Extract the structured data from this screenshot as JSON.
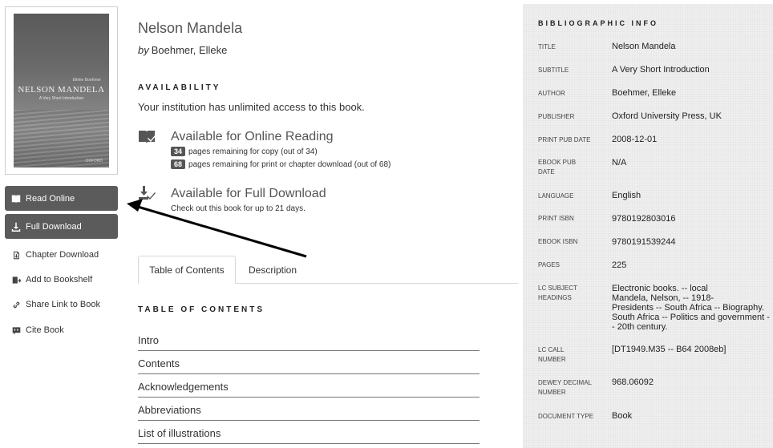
{
  "book": {
    "cover": {
      "author": "Elleke Boehmer",
      "title": "NELSON MANDELA",
      "subtitle": "A Very Short Introduction",
      "publisher": "OXFORD"
    },
    "title": "Nelson Mandela",
    "by_label": "by",
    "author": "Boehmer, Elleke"
  },
  "actions": {
    "read_online": "Read Online",
    "full_download": "Full Download",
    "chapter_download": "Chapter Download",
    "add_to_bookshelf": "Add to Bookshelf",
    "share_link": "Share Link to Book",
    "cite_book": "Cite Book"
  },
  "availability": {
    "heading": "AVAILABILITY",
    "access_text": "Your institution has unlimited access to this book.",
    "online": {
      "title": "Available for Online Reading",
      "copy_count": "34",
      "copy_text": "pages remaining for copy (out of 34)",
      "print_count": "68",
      "print_text": "pages remaining for print or chapter download (out of 68)"
    },
    "download": {
      "title": "Available for Full Download",
      "text": "Check out this book for up to 21 days."
    }
  },
  "tabs": [
    {
      "label": "Table of Contents",
      "active": true
    },
    {
      "label": "Description",
      "active": false
    }
  ],
  "toc": {
    "heading": "TABLE OF CONTENTS",
    "items": [
      "Intro",
      "Contents",
      "Acknowledgements",
      "Abbreviations",
      "List of illustrations"
    ]
  },
  "biblio": {
    "heading": "BIBLIOGRAPHIC INFO",
    "rows": [
      {
        "label": "TITLE",
        "value": "Nelson Mandela"
      },
      {
        "label": "SUBTITLE",
        "value": "A Very Short Introduction"
      },
      {
        "label": "AUTHOR",
        "value": "Boehmer, Elleke"
      },
      {
        "label": "PUBLISHER",
        "value": "Oxford University Press, UK"
      },
      {
        "label": "PRINT PUB DATE",
        "value": "2008-12-01"
      },
      {
        "label": "EBOOK PUB DATE",
        "value": "N/A"
      },
      {
        "label": "LANGUAGE",
        "value": "English"
      },
      {
        "label": "PRINT ISBN",
        "value": "9780192803016"
      },
      {
        "label": "EBOOK ISBN",
        "value": "9780191539244"
      },
      {
        "label": "PAGES",
        "value": "225"
      },
      {
        "label": "LC SUBJECT HEADINGS",
        "value": "Electronic books. -- local\nMandela, Nelson, -- 1918-\nPresidents -- South Africa -- Biography.\nSouth Africa -- Politics and government -- 20th century."
      },
      {
        "label": "LC CALL NUMBER",
        "value": "[DT1949.M35 -- B64 2008eb]"
      },
      {
        "label": "DEWEY DECIMAL NUMBER",
        "value": "968.06092"
      },
      {
        "label": "DOCUMENT TYPE",
        "value": "Book"
      }
    ]
  }
}
